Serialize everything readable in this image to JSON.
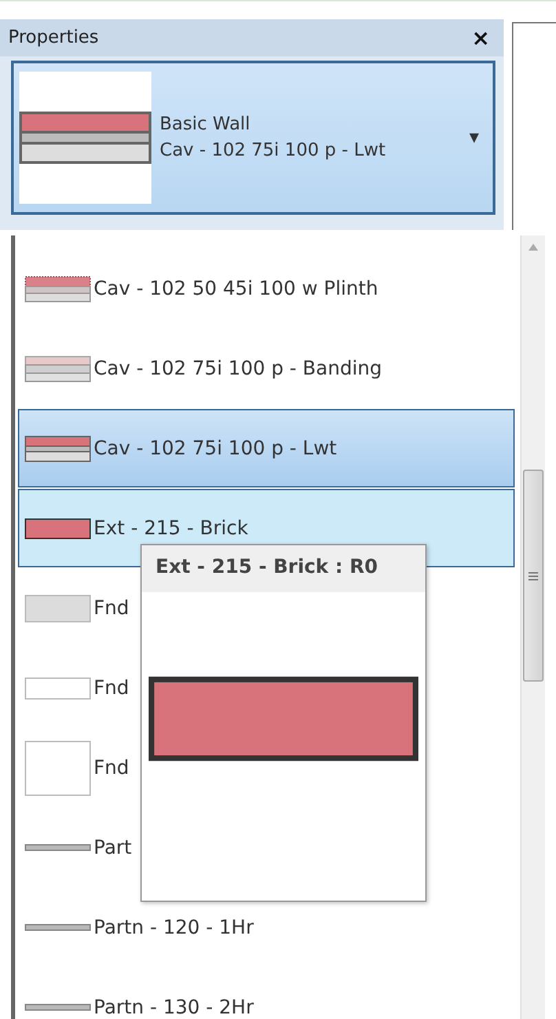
{
  "panel": {
    "title": "Properties",
    "close": "×"
  },
  "type_selector": {
    "family": "Basic Wall",
    "type": "Cav - 102 75i 100 p - Lwt",
    "preview": {
      "kind": "lwt"
    },
    "caret": "▾"
  },
  "type_list": [
    {
      "label": "Cav - 102 50 45i 100 w Plinth",
      "swatch": {
        "kind": "plinth"
      },
      "selected": false,
      "hovered": false
    },
    {
      "label": "Cav - 102 75i 100 p - Banding",
      "swatch": {
        "kind": "banding"
      },
      "selected": false,
      "hovered": false
    },
    {
      "label": "Cav - 102 75i 100 p - Lwt",
      "swatch": {
        "kind": "lwt"
      },
      "selected": true,
      "hovered": false
    },
    {
      "label": "Ext - 215 - Brick",
      "swatch": {
        "kind": "brick"
      },
      "selected": false,
      "hovered": true
    },
    {
      "label": "Fnd",
      "swatch": {
        "kind": "fnd-grey"
      },
      "selected": false,
      "hovered": false
    },
    {
      "label": "Fnd",
      "swatch": {
        "kind": "fnd-white"
      },
      "selected": false,
      "hovered": false
    },
    {
      "label": "Fnd",
      "swatch": {
        "kind": "fnd-tall"
      },
      "selected": false,
      "hovered": false
    },
    {
      "label": "Part",
      "swatch": {
        "kind": "partn"
      },
      "selected": false,
      "hovered": false
    },
    {
      "label": "Partn - 120 - 1Hr",
      "swatch": {
        "kind": "partn"
      },
      "selected": false,
      "hovered": false
    },
    {
      "label": "Partn - 130 - 2Hr",
      "swatch": {
        "kind": "partn"
      },
      "selected": false,
      "hovered": false
    }
  ],
  "tooltip": {
    "title": "Ext - 215 - Brick : R0",
    "preview": {
      "kind": "brick"
    }
  }
}
